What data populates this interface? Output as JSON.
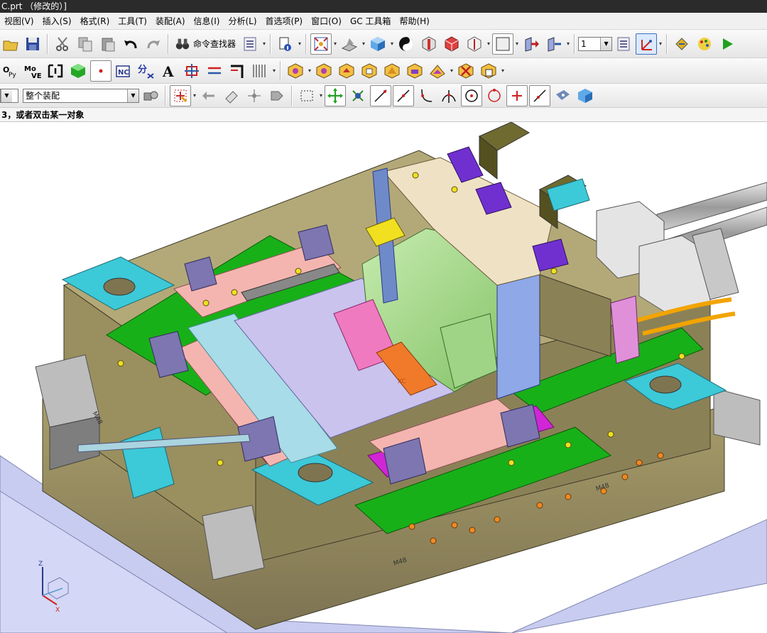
{
  "window": {
    "title": "C.prt （修改的）]"
  },
  "menu": [
    "视图(V)",
    "插入(S)",
    "格式(R)",
    "工具(T)",
    "装配(A)",
    "信息(I)",
    "分析(L)",
    "首选项(P)",
    "窗口(O)",
    "GC 工具箱",
    "帮助(H)"
  ],
  "toolbar1": {
    "command_finder_label": "命令查找器",
    "layer_value": "1"
  },
  "toolbar3": {
    "assembly_filter_value": "整个装配"
  },
  "cue_line": "3，或者双击某一对象",
  "labels": {
    "m48": "M48",
    "xc": "XC"
  },
  "triad": {
    "z": "Z",
    "x": "X"
  },
  "colors": {
    "steel": "#9a8f5f",
    "steel_dark": "#7a7050",
    "cyan": "#3cc9d8",
    "green": "#18b018",
    "magenta": "#d026d6",
    "pink": "#f4b5b0",
    "lightblue": "#a8dce8",
    "lavender": "#c9c3ee",
    "slide_green": "#a6d98a",
    "base_plate": "#c8ccf0"
  }
}
